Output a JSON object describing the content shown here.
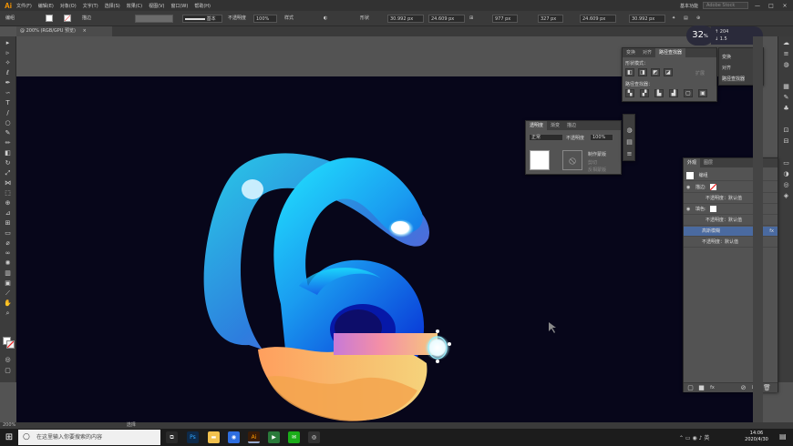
{
  "app": {
    "logo": "Ai"
  },
  "menu": [
    "文件(F)",
    "编辑(E)",
    "对象(O)",
    "文字(T)",
    "选择(S)",
    "效果(C)",
    "视图(V)",
    "窗口(W)",
    "帮助(H)"
  ],
  "menubar_right": {
    "workspace": "基本功能",
    "search_placeholder": "Adobe Stock",
    "minimize": "—",
    "maximize": "□",
    "close": "×"
  },
  "controlbar": {
    "mode": "编组",
    "stroke_label": "描边",
    "brush": "基本",
    "opacity_label": "不透明度",
    "opacity": "100%",
    "style_label": "样式",
    "shape_label": "形状",
    "x": "30.992 px",
    "y": "24.609 px",
    "w": "977 px",
    "w2": "327 px",
    "h": "24.609 px",
    "h2": "30.992 px"
  },
  "document_tab": {
    "label": "@ 200% (RGB/GPU 预览)",
    "close": "×"
  },
  "zoom_badge": {
    "value": "32",
    "unit": "%"
  },
  "net_info": {
    "up": "204",
    "down": "1.5"
  },
  "pathfinder_panel": {
    "tabs": [
      "变换",
      "对齐",
      "路径查找器"
    ],
    "shape_modes_label": "形状模式：",
    "expand_label": "扩展",
    "pathfinders_label": "路径查找器："
  },
  "pathfinder_menu": [
    "变换",
    "对齐",
    "路径查找器"
  ],
  "transparency_panel": {
    "tabs": [
      "透明度",
      "渐变",
      "描边"
    ],
    "blend_mode": "正常",
    "opacity_label": "不透明度",
    "opacity": "100%",
    "make_mask": "制作蒙版",
    "clip": "剪切",
    "invert": "反相蒙版"
  },
  "appearance_panel": {
    "tabs": [
      "外观",
      "图层"
    ],
    "title": "编组",
    "rows": [
      {
        "label": "描边:",
        "sub": ""
      },
      {
        "label": "不透明度：默认值",
        "sub": ""
      },
      {
        "label": "填色:",
        "sub": ""
      },
      {
        "label": "不透明度：默认值",
        "sub": ""
      },
      {
        "label": "高斯模糊",
        "sub": "fx"
      },
      {
        "label": "不透明度：默认值",
        "sub": ""
      }
    ]
  },
  "status": {
    "zoom": "200%",
    "tool": "选择"
  },
  "taskbar": {
    "search_placeholder": "在这里输入你要搜索的内容",
    "time": "14:06",
    "date": "2020/4/30",
    "apps": [
      "Ps",
      "Ai"
    ]
  }
}
